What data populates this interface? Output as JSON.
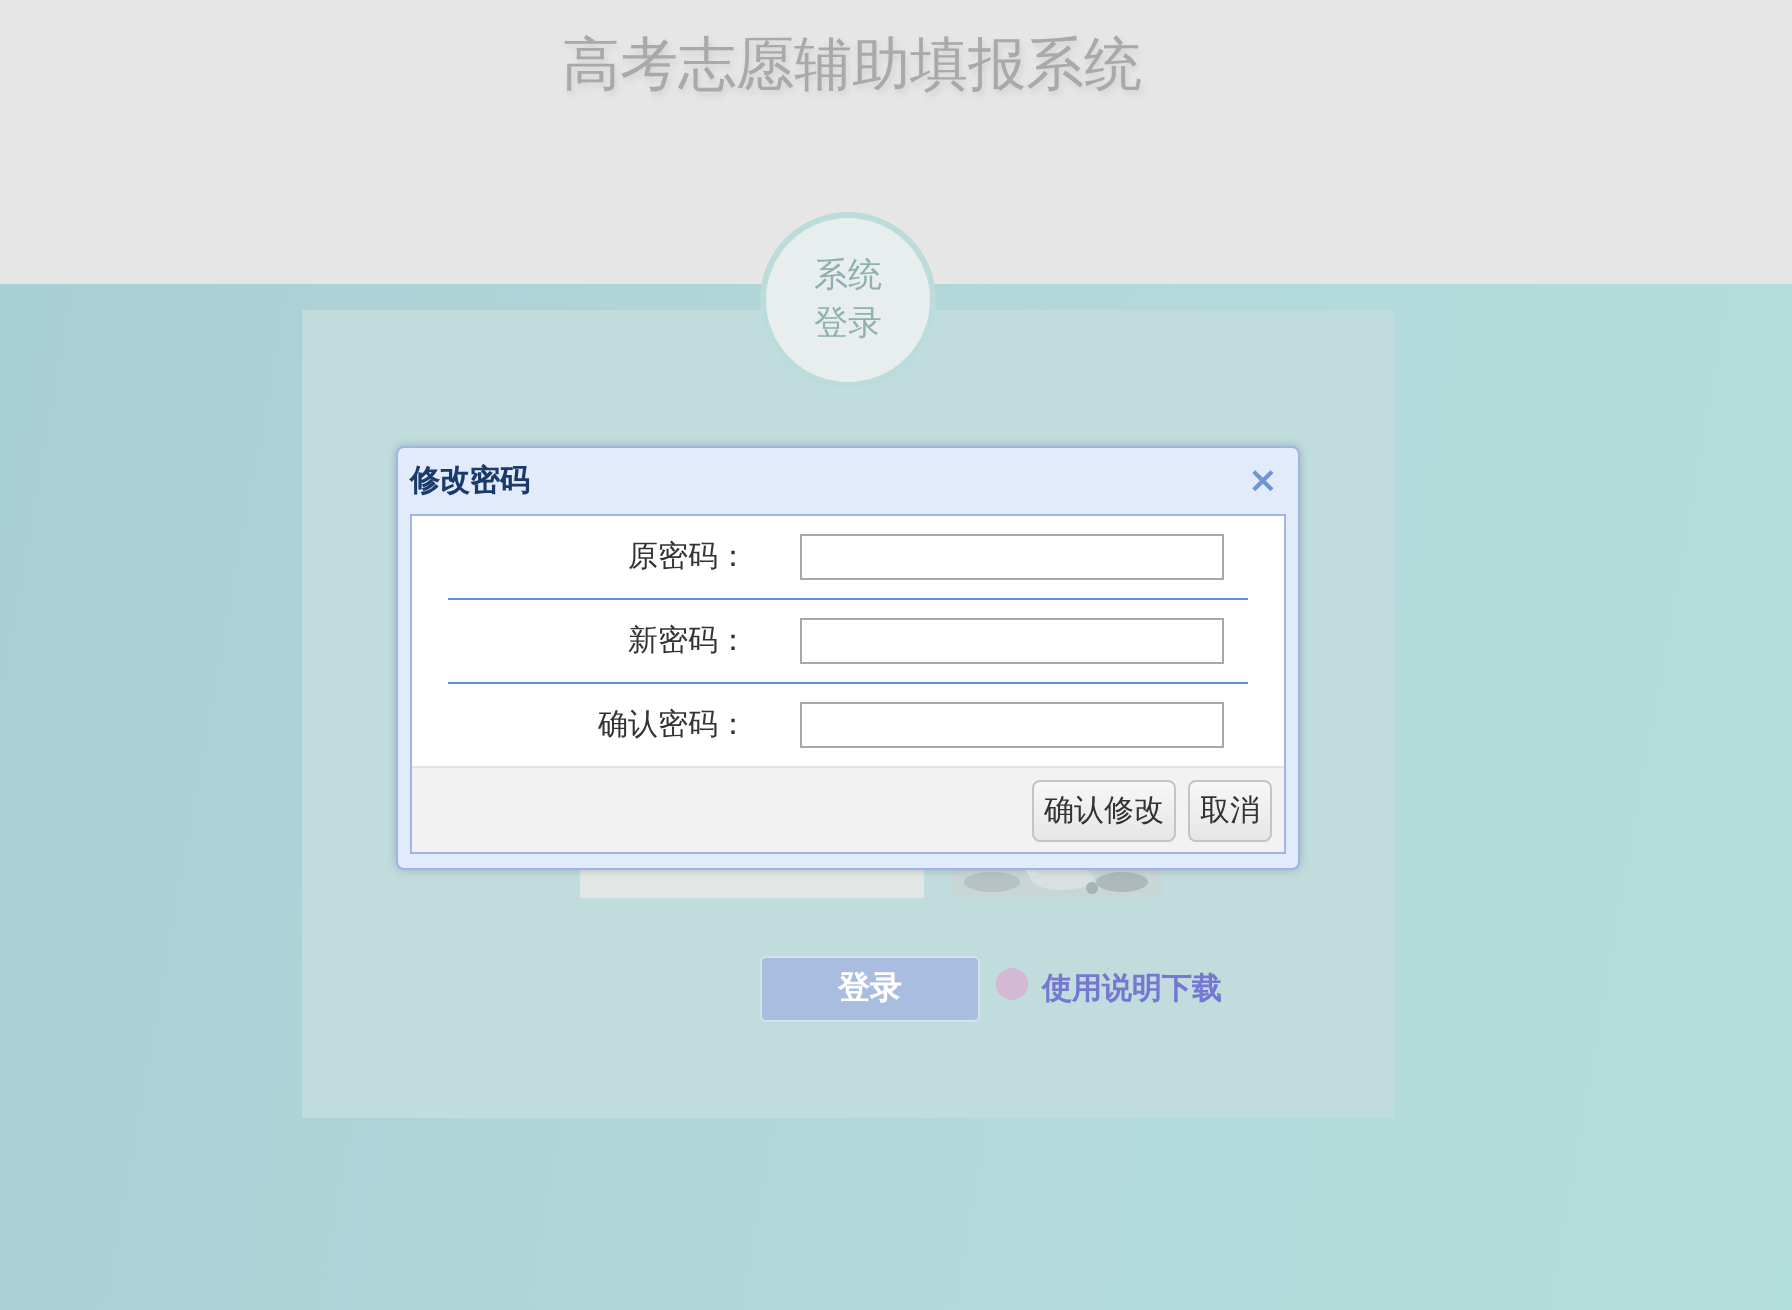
{
  "page": {
    "title": "高考志愿辅助填报系统",
    "badge": "系统登录"
  },
  "login": {
    "submit": "登录",
    "help_link": "使用说明下载"
  },
  "dialog": {
    "title": "修改密码",
    "close": "×",
    "fields": [
      {
        "label": "原密码："
      },
      {
        "label": "新密码："
      },
      {
        "label": "确认密码："
      }
    ],
    "buttons": [
      "确认修改",
      "取消"
    ]
  }
}
